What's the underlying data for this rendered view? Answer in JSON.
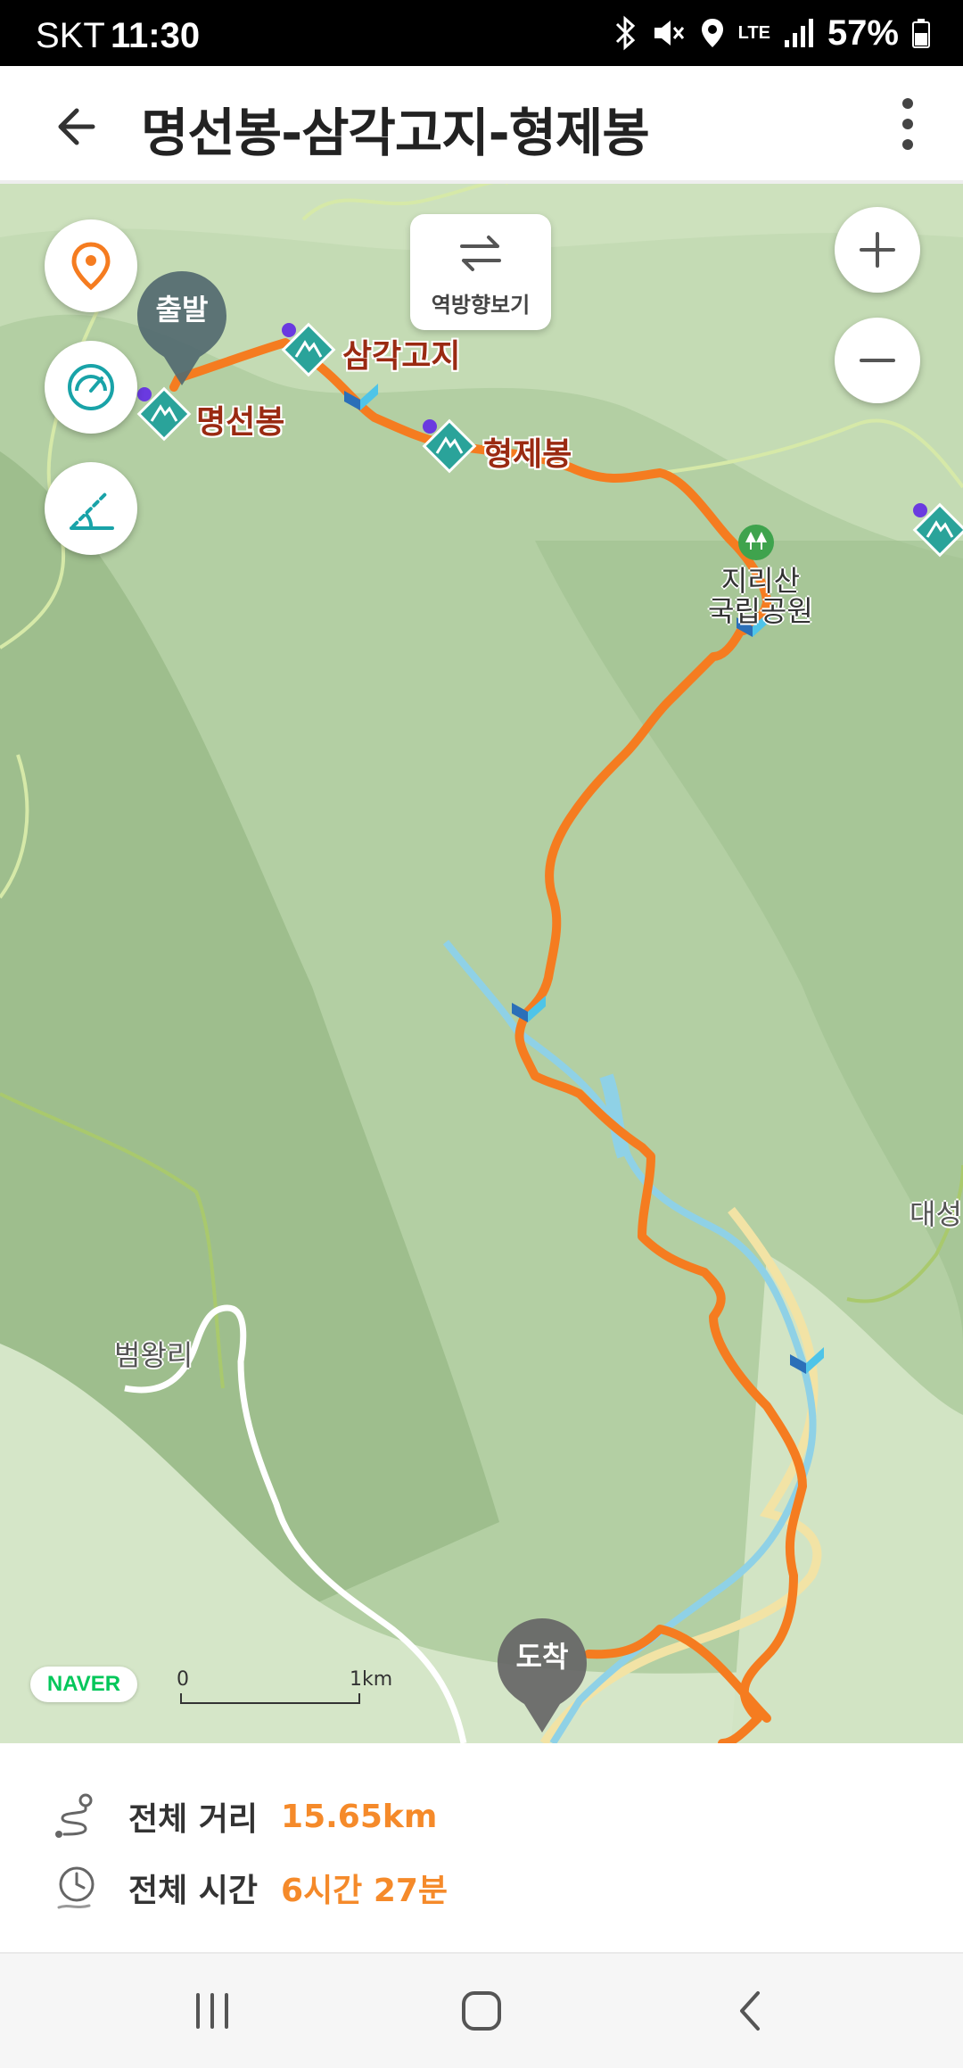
{
  "status_bar": {
    "carrier": "SKT",
    "time": "11:30",
    "network": "LTE",
    "battery": "57%"
  },
  "app_bar": {
    "title": "명선봉-삼각고지-형제봉"
  },
  "map": {
    "reverse_button_label": "역방향보기",
    "start_pin": "출발",
    "end_pin": "도착",
    "peaks": [
      {
        "name": "명선봉"
      },
      {
        "name": "삼각고지"
      },
      {
        "name": "형제봉"
      }
    ],
    "places": {
      "park": "지리산\n국립공원",
      "village": "범왕리",
      "edge_place": "대성"
    },
    "provider": "NAVER",
    "scale_start": "0",
    "scale_end": "1km",
    "route_color": "#f57c20"
  },
  "summary": {
    "distance_label": "전체 거리",
    "distance_value": "15.65km",
    "time_label": "전체 시간",
    "time_value": "6시간 27분"
  },
  "colors": {
    "accent": "#f58a2a",
    "peak_marker": "#2aa39a",
    "peak_label": "#9a2a12"
  }
}
